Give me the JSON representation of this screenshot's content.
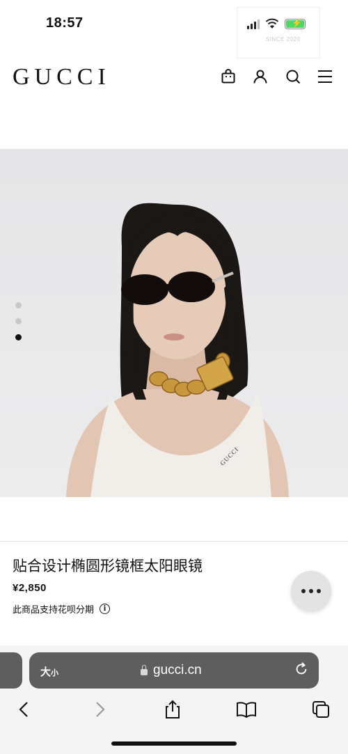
{
  "status_bar": {
    "time": "18:57",
    "watermark": "SINCE 2020"
  },
  "header": {
    "brand": "GUCCI",
    "icons": [
      "shopping-bag-icon",
      "user-icon",
      "search-icon",
      "menu-icon"
    ]
  },
  "carousel": {
    "slide_count": 3,
    "active_index": 2
  },
  "product": {
    "title": "贴合设计椭圆形镜框太阳眼镜",
    "price": "¥2,850",
    "installment_text": "此商品支持花呗分期",
    "info_icon": "i"
  },
  "browser": {
    "text_size_label": "大",
    "text_size_small": "小",
    "url": "gucci.cn",
    "nav": [
      "back-icon",
      "forward-icon",
      "share-icon",
      "bookmarks-icon",
      "tabs-icon"
    ]
  },
  "colors": {
    "hero_bg": "#e9e9ea",
    "address_bar": "#5e5e5e",
    "battery": "#4cd964"
  }
}
